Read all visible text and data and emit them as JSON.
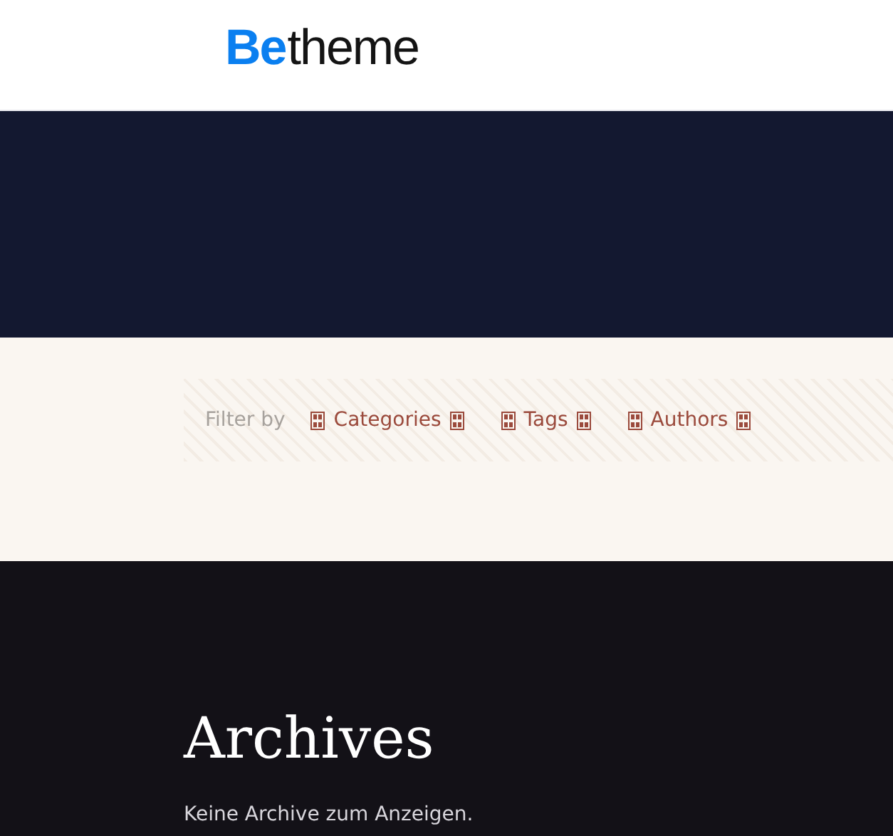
{
  "logo": {
    "accent": "Be",
    "rest": "theme"
  },
  "filter": {
    "label": "Filter by",
    "items": [
      {
        "label": "Categories"
      },
      {
        "label": "Tags"
      },
      {
        "label": "Authors"
      }
    ]
  },
  "archive": {
    "title": "Archives",
    "message": "Keine Archive zum Anzeigen."
  }
}
